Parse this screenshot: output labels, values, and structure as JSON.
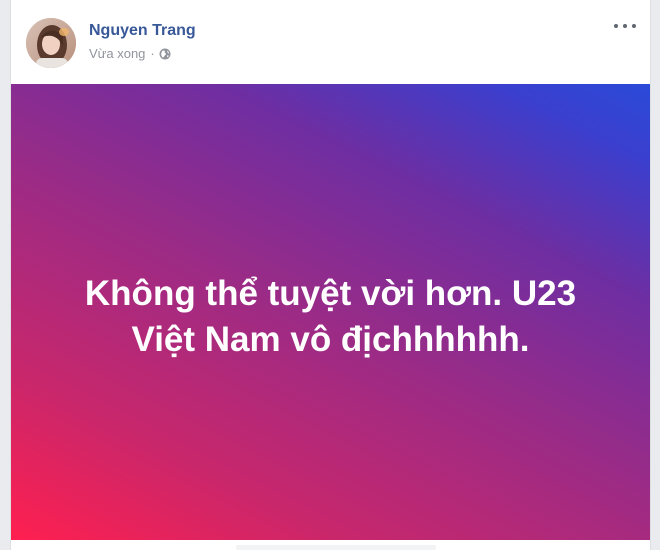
{
  "post": {
    "author_name": "Nguyen Trang",
    "timestamp": "Vừa xong",
    "separator": "·",
    "privacy_icon": "globe-icon",
    "more_icon": "more-options-icon",
    "text": "Không thể tuyệt vời hơn. U23 Việt Nam vô địchhhhhh.",
    "background_gradient_colors": [
      "#ff1f4f",
      "#9b2b86",
      "#2a4ad8"
    ]
  },
  "colors": {
    "author_link": "#385898",
    "meta_text": "#90949c",
    "page_background": "#e9ebee"
  }
}
